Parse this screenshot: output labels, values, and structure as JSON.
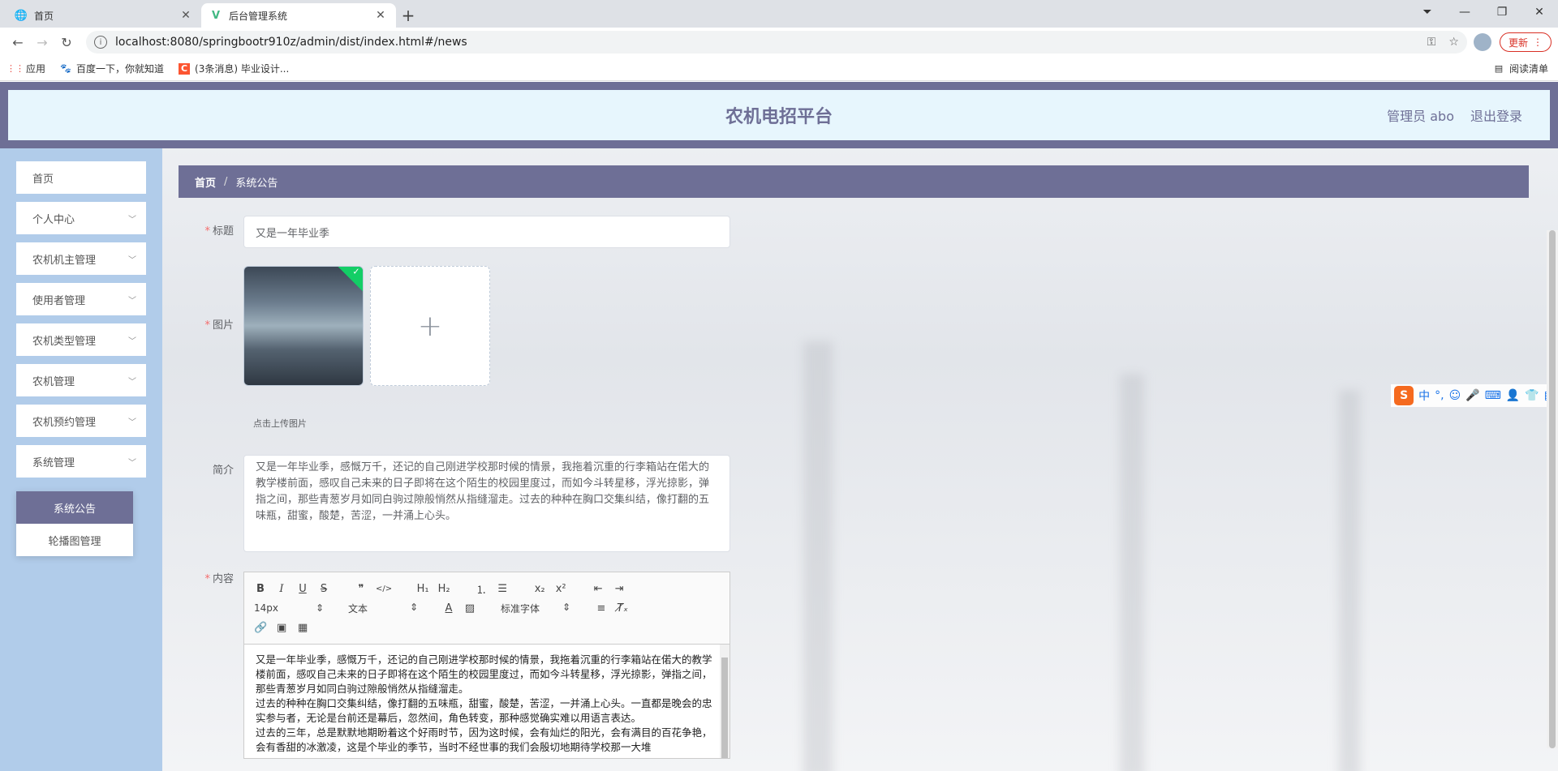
{
  "browser": {
    "tabs": [
      {
        "title": "首页",
        "icon": "globe-icon"
      },
      {
        "title": "后台管理系统",
        "icon": "vue-icon"
      }
    ],
    "url": "localhost:8080/springbootr910z/admin/dist/index.html#/news",
    "update_label": "更新",
    "bookmarks": [
      {
        "label": "应用",
        "icon": "apps-grid-icon"
      },
      {
        "label": "百度一下，你就知道",
        "icon": "baidu-paw-icon"
      },
      {
        "label": "(3条消息) 毕业设计...",
        "icon": "csdn-c-icon"
      }
    ],
    "reading_list": "阅读清单"
  },
  "header": {
    "title": "农机电招平台",
    "user": "管理员 abo",
    "logout": "退出登录"
  },
  "sidebar": {
    "items": [
      {
        "label": "首页",
        "has_children": false
      },
      {
        "label": "个人中心",
        "has_children": true
      },
      {
        "label": "农机机主管理",
        "has_children": true
      },
      {
        "label": "使用者管理",
        "has_children": true
      },
      {
        "label": "农机类型管理",
        "has_children": true
      },
      {
        "label": "农机管理",
        "has_children": true
      },
      {
        "label": "农机预约管理",
        "has_children": true
      },
      {
        "label": "系统管理",
        "has_children": true
      }
    ],
    "submenu": [
      {
        "label": "系统公告",
        "active": true
      },
      {
        "label": "轮播图管理",
        "active": false
      }
    ]
  },
  "breadcrumb": {
    "home": "首页",
    "current": "系统公告"
  },
  "form": {
    "title_label": "标题",
    "title_value": "又是一年毕业季",
    "image_label": "图片",
    "upload_tip": "点击上传图片",
    "intro_label": "简介",
    "intro_value": "又是一年毕业季，感慨万千，还记的自己刚进学校那时候的情景，我拖着沉重的行李箱站在偌大的教学楼前面，感叹自己未来的日子即将在这个陌生的校园里度过，而如今斗转星移，浮光掠影，弹指之间，那些青葱岁月如同白驹过隙般悄然从指缝溜走。过去的种种在胸口交集纠结，像打翻的五味瓶，甜蜜，酸楚，苦涩，一并涌上心头。",
    "content_label": "内容",
    "editor": {
      "size_select": "14px",
      "header_select": "文本",
      "font_select": "标准字体",
      "content": [
        "又是一年毕业季，感慨万千，还记的自己刚进学校那时候的情景，我拖着沉重的行李箱站在偌大的教学楼前面，感叹自己未来的日子即将在这个陌生的校园里度过，而如今斗转星移，浮光掠影，弹指之间，那些青葱岁月如同白驹过隙般悄然从指缝溜走。",
        "过去的种种在胸口交集纠结，像打翻的五味瓶，甜蜜，酸楚，苦涩，一并涌上心头。一直都是晚会的忠实参与者，无论是台前还是幕后，忽然间，角色转变，那种感觉确实难以用语言表达。",
        "过去的三年，总是默默地期盼着这个好雨时节，因为这时候，会有灿烂的阳光，会有满目的百花争艳，会有香甜的冰激凌，这是个毕业的季节，当时不经世事的我们会殷切地期待学校那一大堆"
      ]
    }
  },
  "ime": {
    "labels": [
      "中",
      "°,"
    ]
  }
}
